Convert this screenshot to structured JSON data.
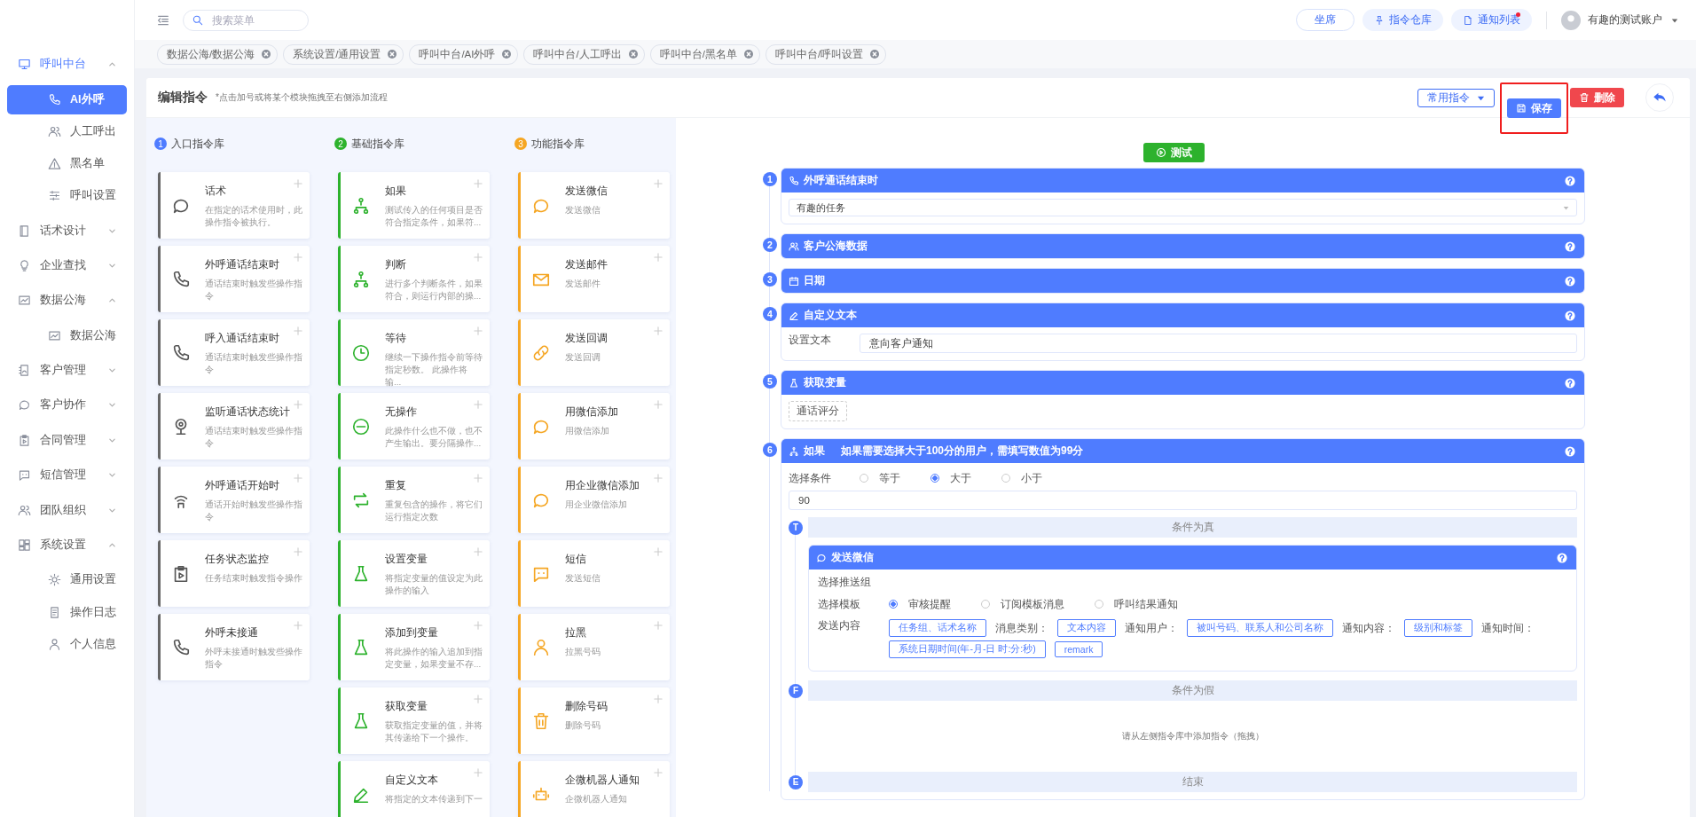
{
  "sidebar": {
    "items": [
      {
        "label": "呼叫中台",
        "selected": true,
        "expanded": true,
        "children": [
          {
            "label": "AI外呼",
            "selected": true
          },
          {
            "label": "人工呼出",
            "selected": false
          },
          {
            "label": "黑名单",
            "selected": false
          },
          {
            "label": "呼叫设置",
            "selected": false
          }
        ]
      },
      {
        "label": "话术设计",
        "selected": false,
        "expanded": false
      },
      {
        "label": "企业查找",
        "selected": false,
        "expanded": false
      },
      {
        "label": "数据公海",
        "selected": false,
        "expanded": true,
        "children": [
          {
            "label": "数据公海",
            "selected": false
          }
        ]
      },
      {
        "label": "客户管理",
        "selected": false,
        "expanded": false
      },
      {
        "label": "客户协作",
        "selected": false,
        "expanded": false
      },
      {
        "label": "合同管理",
        "selected": false,
        "expanded": false
      },
      {
        "label": "短信管理",
        "selected": false,
        "expanded": false
      },
      {
        "label": "团队组织",
        "selected": false,
        "expanded": false
      },
      {
        "label": "系统设置",
        "selected": false,
        "expanded": true,
        "children": [
          {
            "label": "通用设置",
            "selected": false
          },
          {
            "label": "操作日志",
            "selected": false
          },
          {
            "label": "个人信息",
            "selected": false
          }
        ]
      }
    ]
  },
  "header": {
    "search": {
      "placeholder": "搜索菜单"
    },
    "buttons": [
      {
        "label": "坐席",
        "kind": "outline",
        "dot": false
      },
      {
        "label": "指令仓库",
        "kind": "pin",
        "dot": false
      },
      {
        "label": "通知列表",
        "kind": "file",
        "dot": true
      }
    ],
    "account": "有趣的测试账户"
  },
  "tabs": [
    {
      "label": "数据公海/数据公海"
    },
    {
      "label": "系统设置/通用设置"
    },
    {
      "label": "呼叫中台/AI外呼"
    },
    {
      "label": "呼叫中台/人工呼出"
    },
    {
      "label": "呼叫中台/黑名单"
    },
    {
      "label": "呼叫中台/呼叫设置"
    }
  ],
  "page": {
    "title": "编辑指令",
    "hint": "*点击加号或将某个模块拖拽至右侧添加流程",
    "common_button": "常用指令",
    "save_button": "保存",
    "delete_button": "删除",
    "save_highlighted": true
  },
  "library": [
    {
      "number": "1",
      "title": "入口指令库",
      "color": "#4f7cff",
      "kind": "entry",
      "cards": [
        {
          "title": "话术",
          "desc": "在指定的话术使用时，此操作指令被执行。"
        },
        {
          "title": "外呼通话结束时",
          "desc": "通话结束时触发些操作指令"
        },
        {
          "title": "呼入通话结束时",
          "desc": "通话结束时触发些操作指令"
        },
        {
          "title": "监听通话状态统计",
          "desc": "通话结束时触发些操作指令"
        },
        {
          "title": "外呼通话开始时",
          "desc": "通话开始时触发些操作指令"
        },
        {
          "title": "任务状态监控",
          "desc": "任务结束时触发指令操作"
        },
        {
          "title": "外呼未接通",
          "desc": "外呼未接通时触发些操作指令"
        }
      ]
    },
    {
      "number": "2",
      "title": "基础指令库",
      "color": "#2db22d",
      "kind": "basic",
      "cards": [
        {
          "title": "如果",
          "desc": "测试传入的任何项目是否符合指定条件，如果符..."
        },
        {
          "title": "判断",
          "desc": "进行多个判断条件，如果符合，则运行内部的操..."
        },
        {
          "title": "等待",
          "desc": "继续一下操作指令前等待指定秒数。 此操作将输..."
        },
        {
          "title": "无操作",
          "desc": "此操作什么也不做，也不产生输出。要分隔操作..."
        },
        {
          "title": "重复",
          "desc": "重复包含的操作，将它们运行指定次数"
        },
        {
          "title": "设置变量",
          "desc": "将指定变量的值设定为此操作的输入"
        },
        {
          "title": "添加到变量",
          "desc": "将此操作的输入追加到指定变量，如果变量不存..."
        },
        {
          "title": "获取变量",
          "desc": "获取指定变量的值，并将其传递给下一个操作。"
        },
        {
          "title": "自定义文本",
          "desc": "将指定的文本传递到下一"
        }
      ]
    },
    {
      "number": "3",
      "title": "功能指令库",
      "color": "#f5a623",
      "kind": "function",
      "cards": [
        {
          "title": "发送微信",
          "desc": "发送微信"
        },
        {
          "title": "发送邮件",
          "desc": "发送邮件"
        },
        {
          "title": "发送回调",
          "desc": "发送回调"
        },
        {
          "title": "用微信添加",
          "desc": "用微信添加"
        },
        {
          "title": "用企业微信添加",
          "desc": "用企业微信添加"
        },
        {
          "title": "短信",
          "desc": "发送短信"
        },
        {
          "title": "拉黑",
          "desc": "拉黑号码"
        },
        {
          "title": "删除号码",
          "desc": "删除号码"
        },
        {
          "title": "企微机器人通知",
          "desc": "企微机器人通知"
        }
      ]
    }
  ],
  "flow": {
    "test_button": "测试",
    "steps": [
      {
        "number": "1",
        "kind": "select",
        "title": "外呼通话结束时",
        "value": "有趣的任务"
      },
      {
        "number": "2",
        "kind": "plain",
        "title": "客户公海数据"
      },
      {
        "number": "3",
        "kind": "plain",
        "title": "日期"
      },
      {
        "number": "4",
        "kind": "text",
        "title": "自定义文本",
        "label": "设置文本",
        "value": "意向客户通知"
      },
      {
        "number": "5",
        "kind": "tags",
        "title": "获取变量",
        "tags": [
          "通话评分"
        ]
      },
      {
        "number": "6",
        "kind": "if",
        "title": "如果",
        "subtitle": "如果需要选择大于100分的用户，需填写数值为99分",
        "condition_label": "选择条件",
        "options": [
          {
            "label": "等于",
            "selected": false
          },
          {
            "label": "大于",
            "selected": true
          },
          {
            "label": "小于",
            "selected": false
          }
        ],
        "value": "90",
        "true_branch": {
          "marker": "T",
          "label": "条件为真",
          "steps": [
            {
              "kind": "wechat",
              "title": "发送微信",
              "group_label": "选择推送组",
              "template_label": "选择模板",
              "templates": [
                {
                  "label": "审核提醒",
                  "selected": true
                },
                {
                  "label": "订阅模板消息",
                  "selected": false
                },
                {
                  "label": "呼叫结果通知",
                  "selected": false
                }
              ],
              "content_label": "发送内容",
              "content_rows": [
                [
                  {
                    "kind": "tag",
                    "text": "任务组、话术名称"
                  },
                  {
                    "kind": "text",
                    "text": "消息类别："
                  },
                  {
                    "kind": "tag",
                    "text": "文本内容"
                  },
                  {
                    "kind": "text",
                    "text": "通知用户："
                  },
                  {
                    "kind": "tag",
                    "text": "被叫号码、联系人和公司名称"
                  },
                  {
                    "kind": "text",
                    "text": "通知内容："
                  },
                  {
                    "kind": "tag",
                    "text": "级别和标签"
                  },
                  {
                    "kind": "text",
                    "text": "通知时间："
                  }
                ],
                [
                  {
                    "kind": "tag",
                    "text": "系统日期时间(年-月-日 时:分:秒)"
                  },
                  {
                    "kind": "tag",
                    "text": "remark"
                  }
                ]
              ]
            }
          ]
        },
        "false_branch": {
          "marker": "F",
          "label": "条件为假",
          "empty_hint": "请从左侧指令库中添加指令（拖拽）"
        },
        "end": {
          "marker": "E",
          "label": "结束"
        }
      }
    ]
  }
}
